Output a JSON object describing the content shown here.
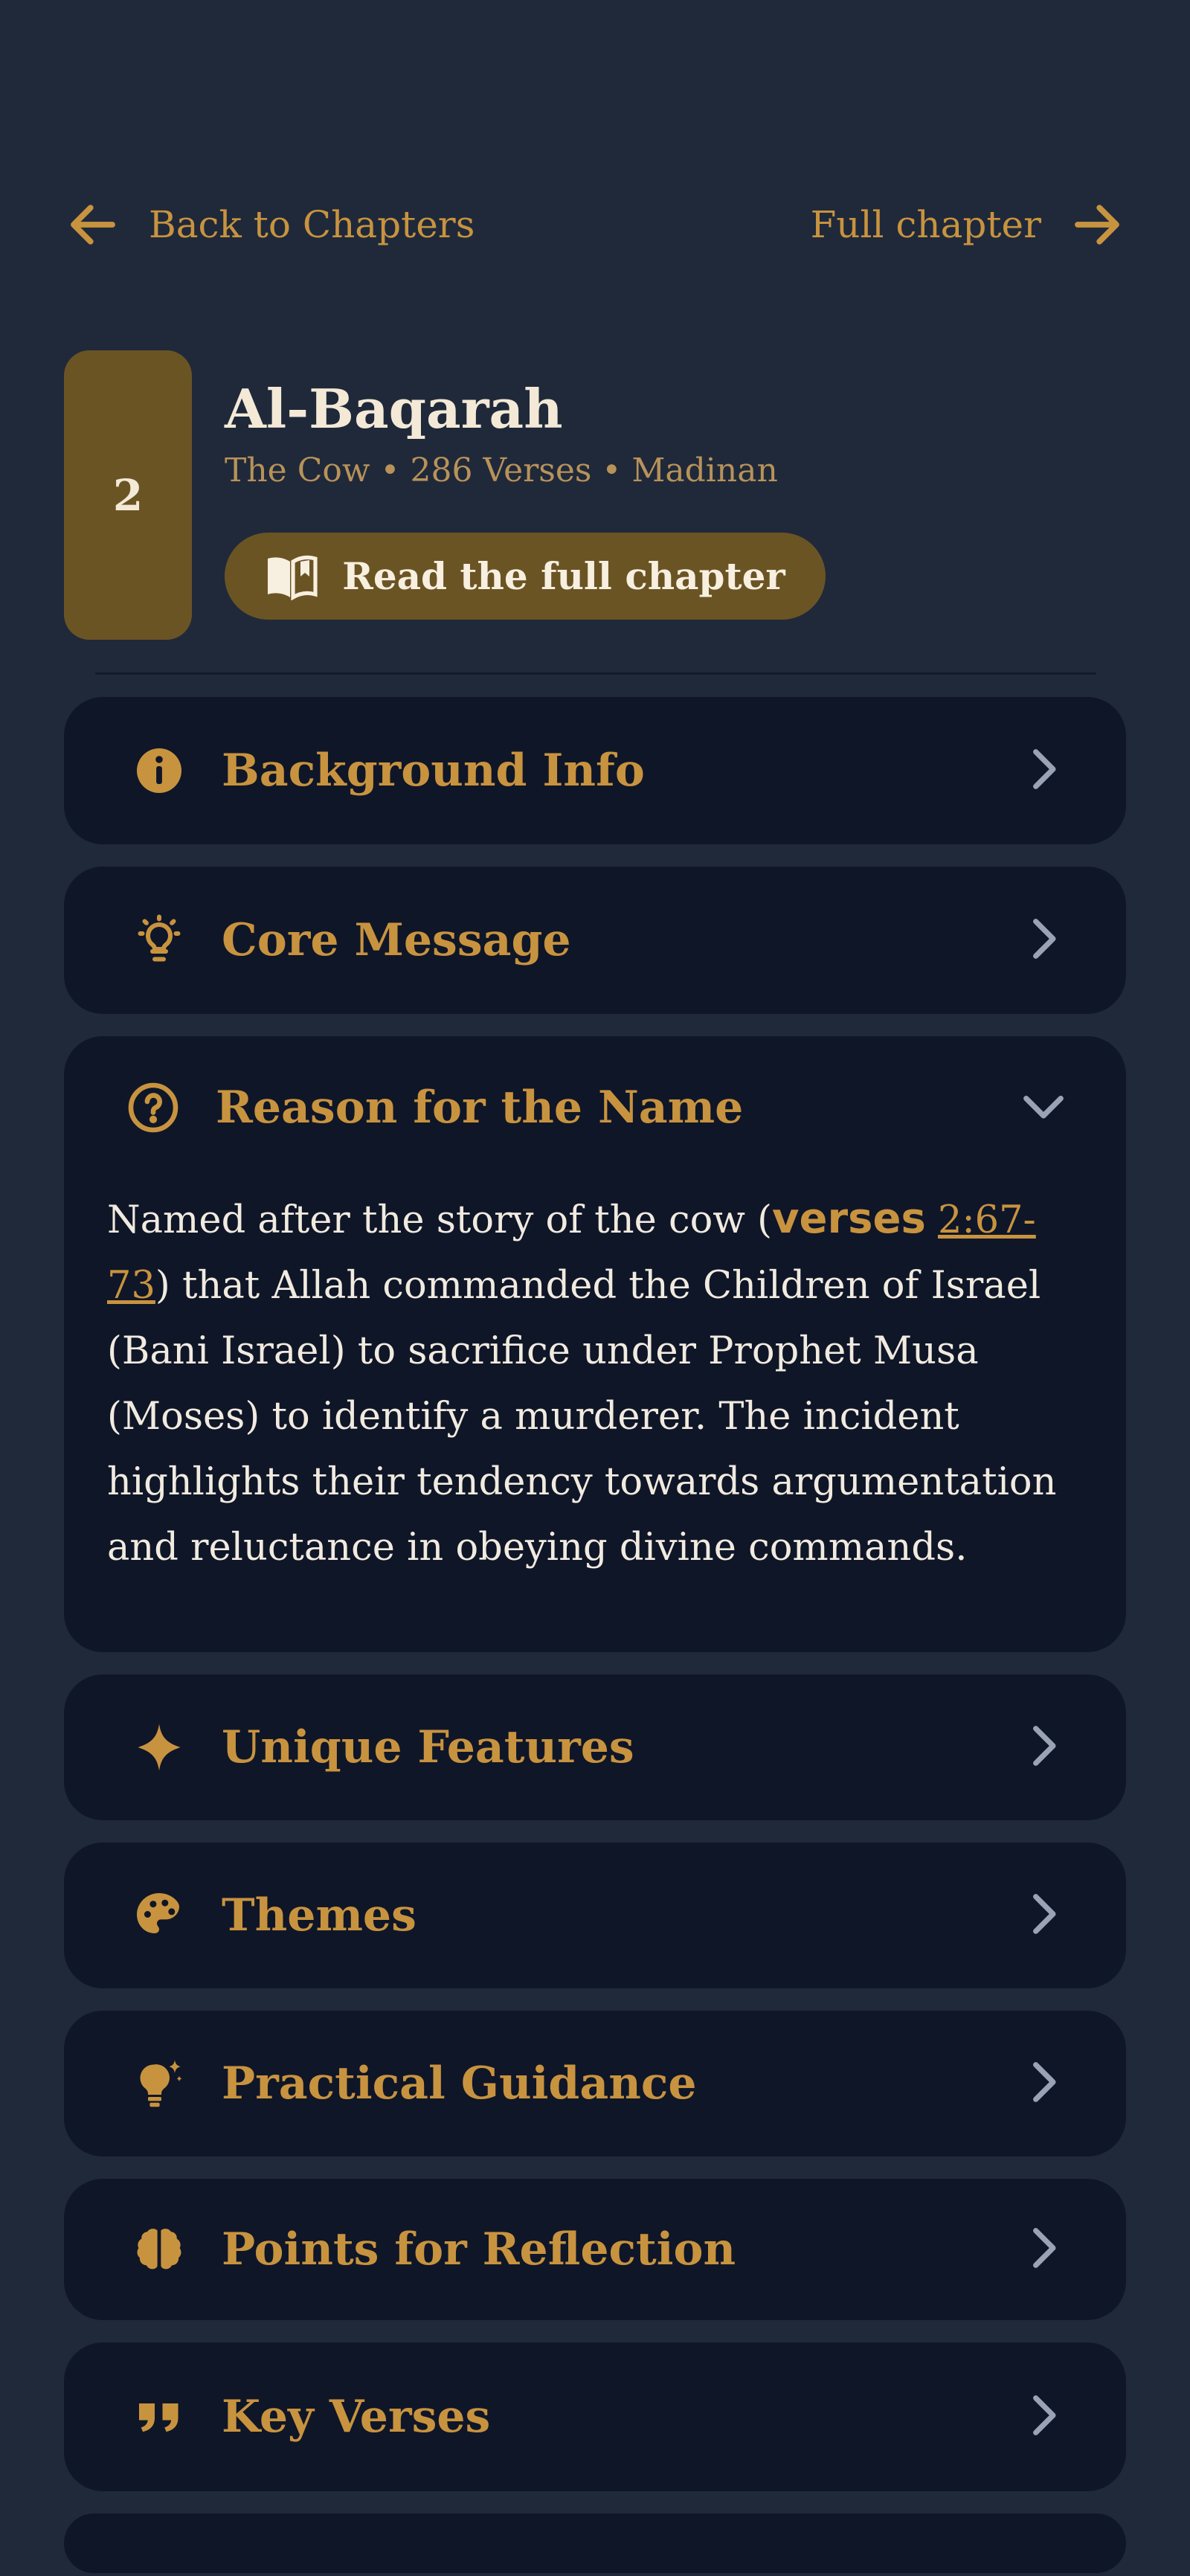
{
  "nav": {
    "back_label": "Back to Chapters",
    "full_label": "Full chapter"
  },
  "chapter": {
    "number": "2",
    "name": "Al-Baqarah",
    "meta": "The Cow • 286 Verses • Madinan",
    "read_button": "Read the full chapter"
  },
  "sections": [
    {
      "title": "Background Info",
      "icon": "info-icon",
      "expanded": false
    },
    {
      "title": "Core Message",
      "icon": "lightbulb-icon",
      "expanded": false
    },
    {
      "title": "Reason for the Name",
      "icon": "question-icon",
      "expanded": true
    },
    {
      "title": "Unique Features",
      "icon": "sparkle-icon",
      "expanded": false
    },
    {
      "title": "Themes",
      "icon": "palette-icon",
      "expanded": false
    },
    {
      "title": "Practical Guidance",
      "icon": "lightbulb-spark-icon",
      "expanded": false
    },
    {
      "title": "Points for Reflection",
      "icon": "brain-icon",
      "expanded": false
    },
    {
      "title": "Key Verses",
      "icon": "quote-icon",
      "expanded": false
    }
  ],
  "reason_body": {
    "before": "Named after the story of the cow (",
    "verses_label": "verses",
    "verse_ref": "2:67-73",
    "after": ") that Allah commanded the Children of Israel (Bani Israel) to sacrifice under Prophet Musa (Moses) to identify a murderer. The incident highlights their tendency towards argumentation and reluctance in obeying divine commands."
  },
  "colors": {
    "background": "#1f293a",
    "card": "#0f1628",
    "accent": "#c8933f",
    "badge": "#6b5424",
    "text_light": "#f3e9d6"
  }
}
